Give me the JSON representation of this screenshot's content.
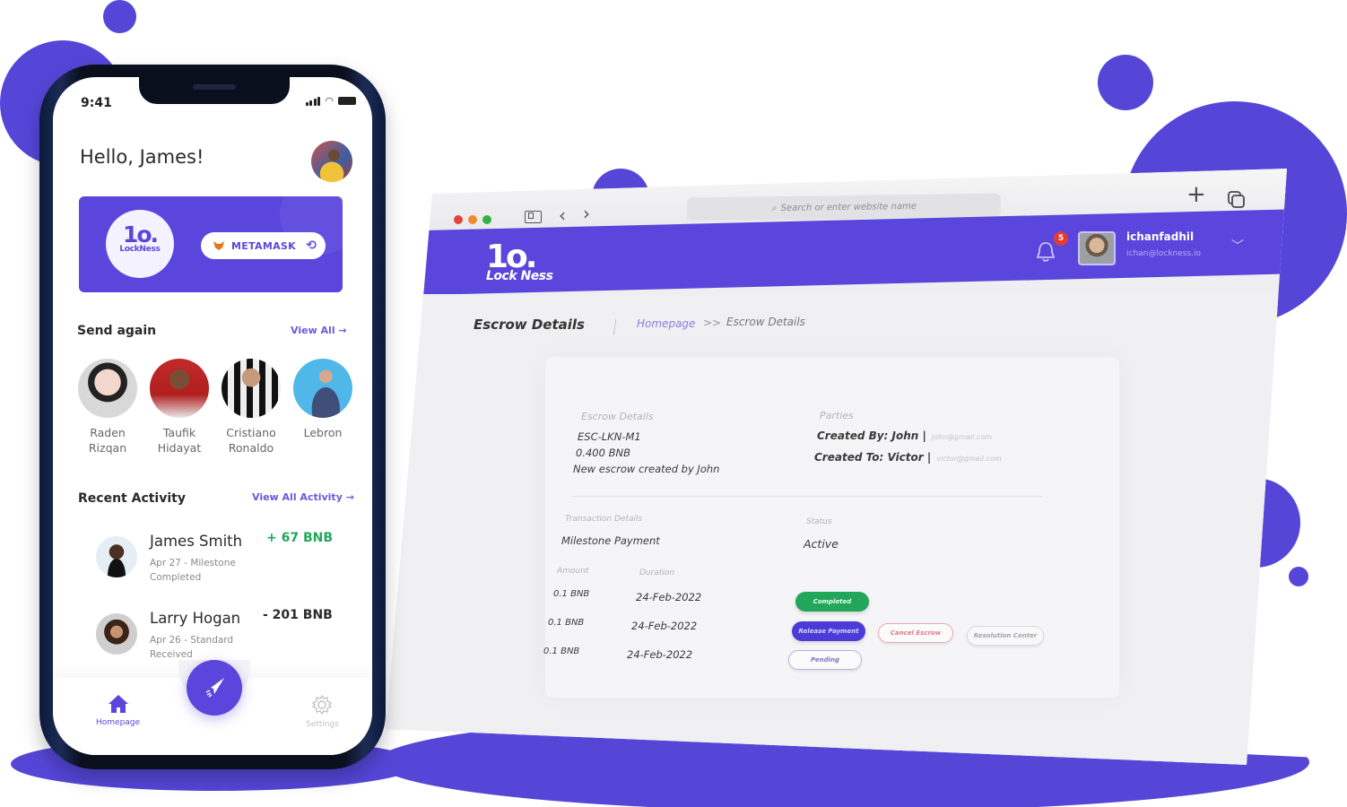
{
  "colors": {
    "brand": "#5546d8",
    "positive": "#22a65a",
    "danger": "#e53935"
  },
  "phone": {
    "status_bar": {
      "time": "9:41"
    },
    "greeting": "Hello, James!",
    "wallet": {
      "logo_mark": "1o.",
      "logo_word": "LockNess",
      "provider_label": "METAMASK",
      "provider_icon": "metamask-fox-icon",
      "refresh_icon": "refresh-icon"
    },
    "send_again": {
      "title": "Send again",
      "view_all": "View All →",
      "contacts": [
        {
          "first": "Raden",
          "last": "Rizqan"
        },
        {
          "first": "Taufik",
          "last": "Hidayat"
        },
        {
          "first": "Cristiano",
          "last": "Ronaldo"
        },
        {
          "first": "Lebron",
          "last": ""
        }
      ]
    },
    "recent_activity": {
      "title": "Recent Activity",
      "view_all": "View All Activity →",
      "items": [
        {
          "name": "James Smith",
          "line1": "Apr 27 - Milestone",
          "line2": "Completed",
          "amount": "+ 67 BNB",
          "direction": "in"
        },
        {
          "name": "Larry Hogan",
          "line1": "Apr 26 - Standard",
          "line2": "Received",
          "amount": "- 201 BNB",
          "direction": "out"
        }
      ]
    },
    "tabbar": {
      "home": "Homepage",
      "settings": "Settings"
    }
  },
  "browser": {
    "url_placeholder": "Search or enter website name",
    "app": {
      "logo_mark": "1o.",
      "logo_word": "Lock Ness",
      "notifications": "5",
      "user_name": "ichanfadhil",
      "user_email": "ichan@lockness.io"
    },
    "page_title": "Escrow Details",
    "breadcrumb": {
      "home": "Homepage",
      "separator": ">>",
      "current": "Escrow Details"
    },
    "escrow": {
      "section_label": "Escrow Details",
      "id": "ESC-LKN-M1",
      "amount": "0.400 BNB",
      "description": "New escrow created by John"
    },
    "parties": {
      "section_label": "Parties",
      "created_by": "Created By: John |",
      "created_by_email": "john@gmail.com",
      "created_to": "Created To: Victor |",
      "created_to_email": "victor@gmail.com"
    },
    "transaction": {
      "section_label": "Transaction Details",
      "type": "Milestone Payment",
      "status_label": "Status",
      "status": "Active",
      "col_amount": "Amount",
      "col_duration": "Duration",
      "rows": [
        {
          "amount": "0.1 BNB",
          "duration": "24-Feb-2022"
        },
        {
          "amount": "0.1 BNB",
          "duration": "24-Feb-2022"
        },
        {
          "amount": "0.1 BNB",
          "duration": "24-Feb-2022"
        }
      ]
    },
    "actions": {
      "completed": "Completed",
      "release_payment": "Release Payment",
      "cancel_escrow": "Cancel Escrow",
      "resolution_center": "Resolution Center",
      "pending": "Pending"
    }
  }
}
